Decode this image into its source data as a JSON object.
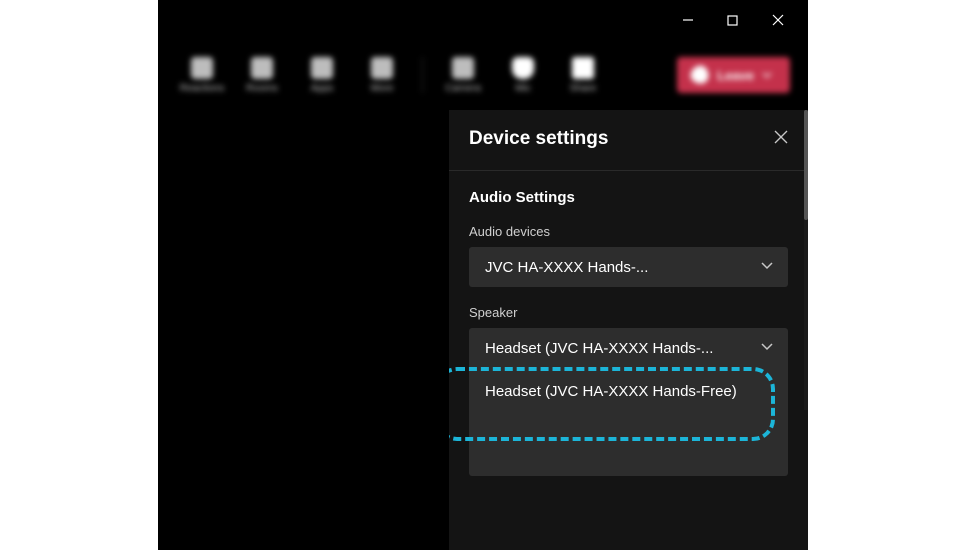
{
  "window": {
    "minimize_tooltip": "Minimize",
    "maximize_tooltip": "Maximize",
    "close_tooltip": "Close"
  },
  "toolbar": {
    "items": [
      {
        "label": "Reactions"
      },
      {
        "label": "Rooms"
      },
      {
        "label": "Apps"
      },
      {
        "label": "More"
      },
      {
        "label": "Camera"
      },
      {
        "label": "Mic"
      },
      {
        "label": "Share"
      }
    ],
    "leave_label": "Leave"
  },
  "panel": {
    "title": "Device settings",
    "section_title": "Audio Settings",
    "audio_devices_label": "Audio devices",
    "audio_devices_value": "JVC HA-XXXX Hands-...",
    "speaker_label": "Speaker",
    "speaker_value": "Headset (JVC HA-XXXX Hands-...",
    "speaker_option_1": "Headset (JVC HA-XXXX Hands-Free)"
  }
}
